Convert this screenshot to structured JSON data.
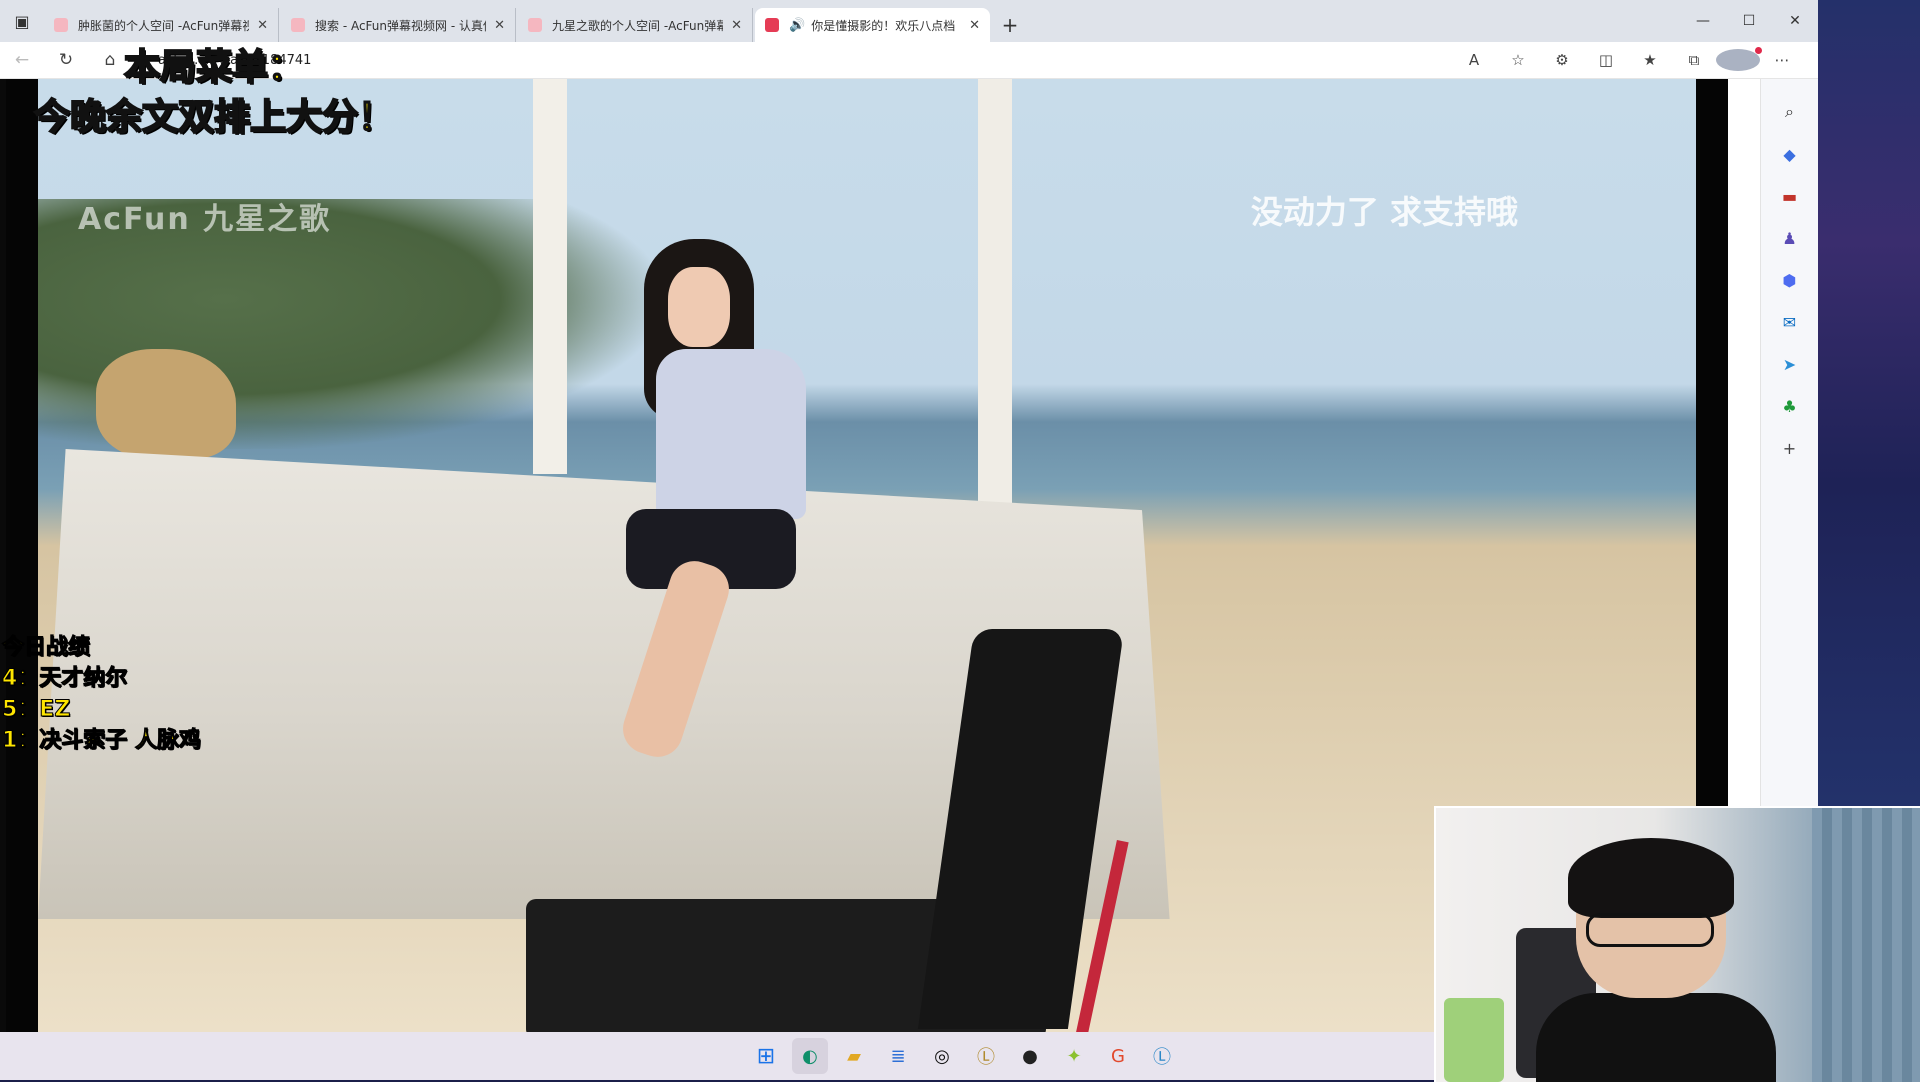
{
  "browser": {
    "tabs": [
      {
        "title": "肿胀菌的个人空间 -AcFun弹幕视",
        "active": false,
        "audio": false
      },
      {
        "title": "搜索 - AcFun弹幕视频网 - 认真你",
        "active": false,
        "audio": false
      },
      {
        "title": "九星之歌的个人空间 -AcFun弹幕",
        "active": false,
        "audio": false
      },
      {
        "title": "你是懂摄影的！欢乐八点档",
        "active": true,
        "audio": true
      }
    ],
    "url": "acfun.cn/v/ac41184741"
  },
  "video_overlay": {
    "menu_title": "本局菜单：",
    "menu_subtitle": "今晚余文双排上大分！",
    "watermark": "AcFun 九星之歌",
    "support_text": "没动力了 求支持哦",
    "stats": [
      "今日战绩",
      "4：天才纳尔",
      "5：EZ",
      "1：决斗索子 人脉鸡"
    ]
  },
  "sidebar_icons": [
    "search-icon",
    "tag-icon",
    "briefcase-icon",
    "chess-icon",
    "office-icon",
    "outlook-icon",
    "send-icon",
    "tree-icon",
    "plus-icon"
  ],
  "taskbar_icons": [
    "windows-icon",
    "edge-icon",
    "file-explorer-icon",
    "notepad-icon",
    "app-icon",
    "league-icon",
    "obs-icon",
    "game-icon",
    "g-icon",
    "league-icon-2"
  ],
  "colors": {
    "overlay_yellow": "#ffe600",
    "tab_active_favicon": "#e53c55"
  }
}
